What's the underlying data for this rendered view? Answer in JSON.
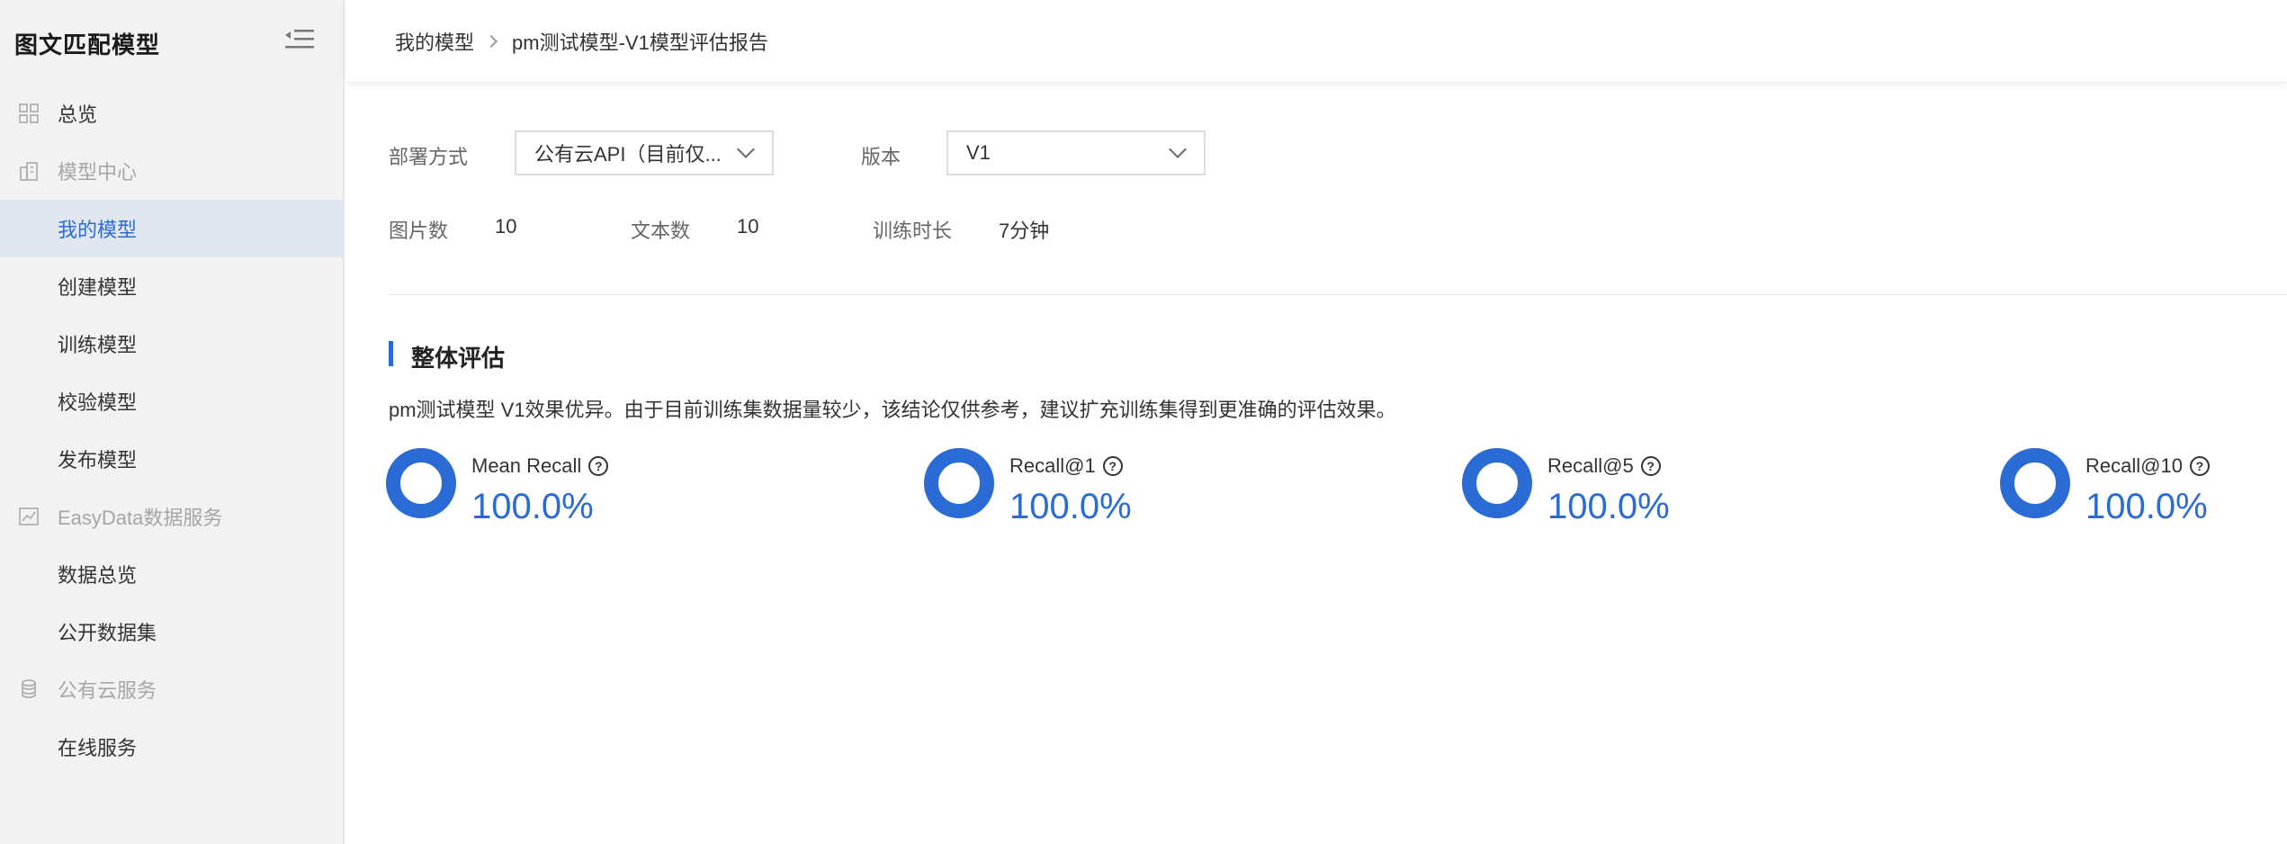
{
  "app": {
    "title": "图文匹配模型",
    "collapse_icon": "menu-collapse-icon"
  },
  "sidebar": {
    "items": [
      {
        "label": "总览",
        "icon": "grid-icon",
        "type": "item"
      },
      {
        "label": "模型中心",
        "icon": "building-icon",
        "type": "group"
      },
      {
        "label": "我的模型",
        "type": "sub",
        "active": true
      },
      {
        "label": "创建模型",
        "type": "sub"
      },
      {
        "label": "训练模型",
        "type": "sub"
      },
      {
        "label": "校验模型",
        "type": "sub"
      },
      {
        "label": "发布模型",
        "type": "sub"
      },
      {
        "label": "EasyData数据服务",
        "icon": "chart-icon",
        "type": "group"
      },
      {
        "label": "数据总览",
        "type": "sub"
      },
      {
        "label": "公开数据集",
        "type": "sub"
      },
      {
        "label": "公有云服务",
        "icon": "database-icon",
        "type": "group"
      },
      {
        "label": "在线服务",
        "type": "sub"
      }
    ]
  },
  "breadcrumb": {
    "parent": "我的模型",
    "current": "pm测试模型-V1模型评估报告"
  },
  "filters": {
    "deploy_label": "部署方式",
    "deploy_value": "公有云API（目前仅...",
    "version_label": "版本",
    "version_value": "V1"
  },
  "stats": {
    "images_label": "图片数",
    "images_value": "10",
    "texts_label": "文本数",
    "texts_value": "10",
    "duration_label": "训练时长",
    "duration_value": "7分钟"
  },
  "evaluation": {
    "title": "整体评估",
    "summary": "pm测试模型 V1效果优异。由于目前训练集数据量较少，该结论仅供参考，建议扩充训练集得到更准确的评估效果。",
    "metrics": [
      {
        "name": "Mean Recall",
        "value": "100.0%"
      },
      {
        "name": "Recall@1",
        "value": "100.0%"
      },
      {
        "name": "Recall@5",
        "value": "100.0%"
      },
      {
        "name": "Recall@10",
        "value": "100.0%"
      }
    ]
  },
  "colors": {
    "accent": "#2b6bd6",
    "sidebar_bg": "#f2f2f2",
    "active_bg": "#e1e7f1"
  }
}
